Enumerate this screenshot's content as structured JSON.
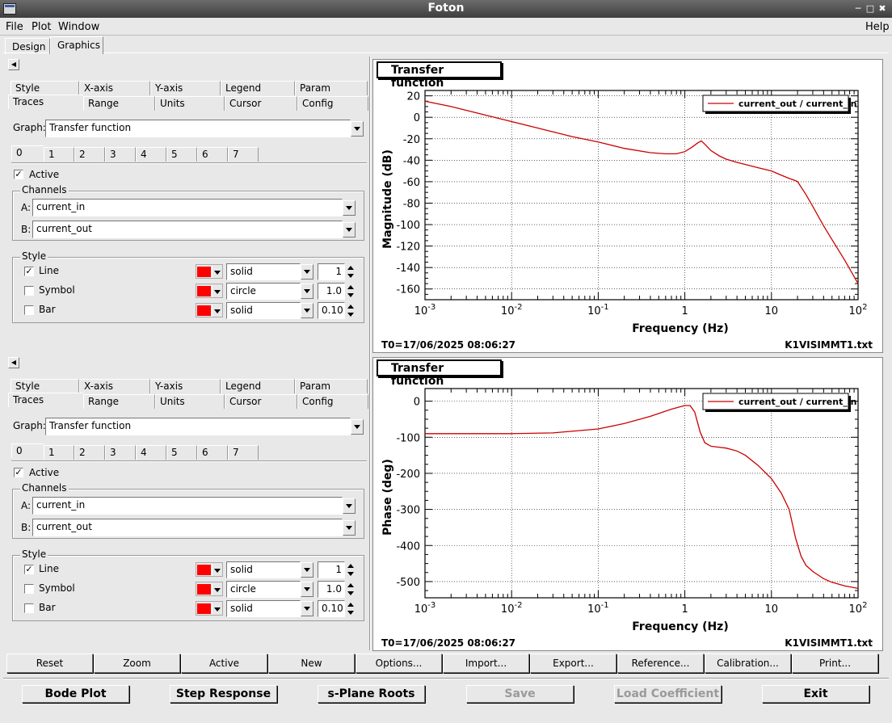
{
  "window": {
    "title": "Foton"
  },
  "menubar": {
    "file": "File",
    "plot": "Plot",
    "window": "Window",
    "help": "Help"
  },
  "main_tabs": [
    "Design",
    "Graphics"
  ],
  "options_panel": {
    "subtabs_row1": [
      "Style",
      "X-axis",
      "Y-axis",
      "Legend",
      "Param"
    ],
    "subtabs_row2": [
      "Traces",
      "Range",
      "Units",
      "Cursor",
      "Config"
    ],
    "graph_label": "Graph:",
    "graph_value": "Transfer function",
    "trace_tabs": [
      "0",
      "1",
      "2",
      "3",
      "4",
      "5",
      "6",
      "7"
    ],
    "active_label": "Active",
    "channels_title": "Channels",
    "channel_a_label": "A:",
    "channel_a_value": "current_in",
    "channel_b_label": "B:",
    "channel_b_value": "current_out",
    "style_title": "Style",
    "line_label": "Line",
    "symbol_label": "Symbol",
    "bar_label": "Bar",
    "line_style": "solid",
    "symbol_style": "circle",
    "bar_style": "solid",
    "line_width": "1",
    "symbol_size": "1.0",
    "bar_width": "0.10",
    "trace_color": "#ff0000",
    "line_checked": true,
    "active_checked": true
  },
  "plots": [
    {
      "title": "Transfer function",
      "footer_left": "T0=17/06/2025 08:06:27",
      "footer_right": "K1VISIMMT1.txt"
    },
    {
      "title": "Transfer function",
      "footer_left": "T0=17/06/2025 08:06:27",
      "footer_right": "K1VISIMMT1.txt"
    }
  ],
  "chart_data": [
    {
      "type": "line",
      "xlabel": "Frequency (Hz)",
      "ylabel": "Magnitude (dB)",
      "xscale": "log",
      "xlim": [
        0.001,
        100
      ],
      "ylim": [
        -170,
        25
      ],
      "yticks": [
        20,
        0,
        -20,
        -40,
        -60,
        -80,
        -100,
        -120,
        -140,
        -160
      ],
      "xtick_labels": [
        "10",
        "10",
        "10",
        "1",
        "10",
        "10"
      ],
      "xtick_exponents": [
        "-3",
        "-2",
        "-1",
        "",
        "",
        "2"
      ],
      "grid": true,
      "legend_position": "top-right",
      "series": [
        {
          "name": "current_out / current_in",
          "color": "#cc0000",
          "x": [
            0.001,
            0.002,
            0.005,
            0.01,
            0.02,
            0.05,
            0.1,
            0.2,
            0.4,
            0.6,
            0.8,
            1.0,
            1.2,
            1.4,
            1.55,
            1.7,
            2.0,
            2.5,
            3,
            4,
            5,
            7,
            10,
            13,
            16,
            19,
            20,
            25,
            30,
            40,
            50,
            70,
            100
          ],
          "y": [
            15,
            10,
            2,
            -4,
            -10,
            -18,
            -23,
            -29,
            -33,
            -34,
            -34,
            -32,
            -28,
            -24,
            -22,
            -25,
            -31,
            -36,
            -39,
            -42,
            -44,
            -47,
            -50,
            -54,
            -57,
            -59,
            -60,
            -72,
            -83,
            -101,
            -114,
            -133,
            -155
          ]
        }
      ]
    },
    {
      "type": "line",
      "xlabel": "Frequency (Hz)",
      "ylabel": "Phase (deg)",
      "xscale": "log",
      "xlim": [
        0.001,
        100
      ],
      "ylim": [
        -545,
        35
      ],
      "yticks": [
        0,
        -100,
        -200,
        -300,
        -400,
        -500
      ],
      "xtick_labels": [
        "10",
        "10",
        "10",
        "1",
        "10",
        "10"
      ],
      "xtick_exponents": [
        "-3",
        "-2",
        "-1",
        "",
        "",
        "2"
      ],
      "grid": true,
      "legend_position": "top-right",
      "series": [
        {
          "name": "current_out / current_in",
          "color": "#cc0000",
          "x": [
            0.001,
            0.003,
            0.01,
            0.03,
            0.1,
            0.2,
            0.4,
            0.7,
            1.0,
            1.15,
            1.3,
            1.5,
            1.7,
            2.0,
            3,
            4,
            5,
            7,
            10,
            13,
            16,
            19,
            22,
            25,
            30,
            40,
            50,
            70,
            100
          ],
          "y": [
            -90,
            -90,
            -90,
            -88,
            -77,
            -62,
            -42,
            -22,
            -12,
            -12,
            -30,
            -85,
            -115,
            -125,
            -130,
            -138,
            -150,
            -178,
            -215,
            -255,
            -300,
            -380,
            -430,
            -455,
            -472,
            -492,
            -502,
            -512,
            -519
          ]
        }
      ]
    }
  ],
  "plot_toolbar": [
    "Reset",
    "Zoom",
    "Active",
    "New",
    "Options...",
    "Import...",
    "Export...",
    "Reference...",
    "Calibration...",
    "Print..."
  ],
  "bottom_buttons": {
    "bode": "Bode Plot",
    "step": "Step Response",
    "splane": "s-Plane Roots",
    "save": "Save",
    "load": "Load Coefficient",
    "exit": "Exit"
  }
}
